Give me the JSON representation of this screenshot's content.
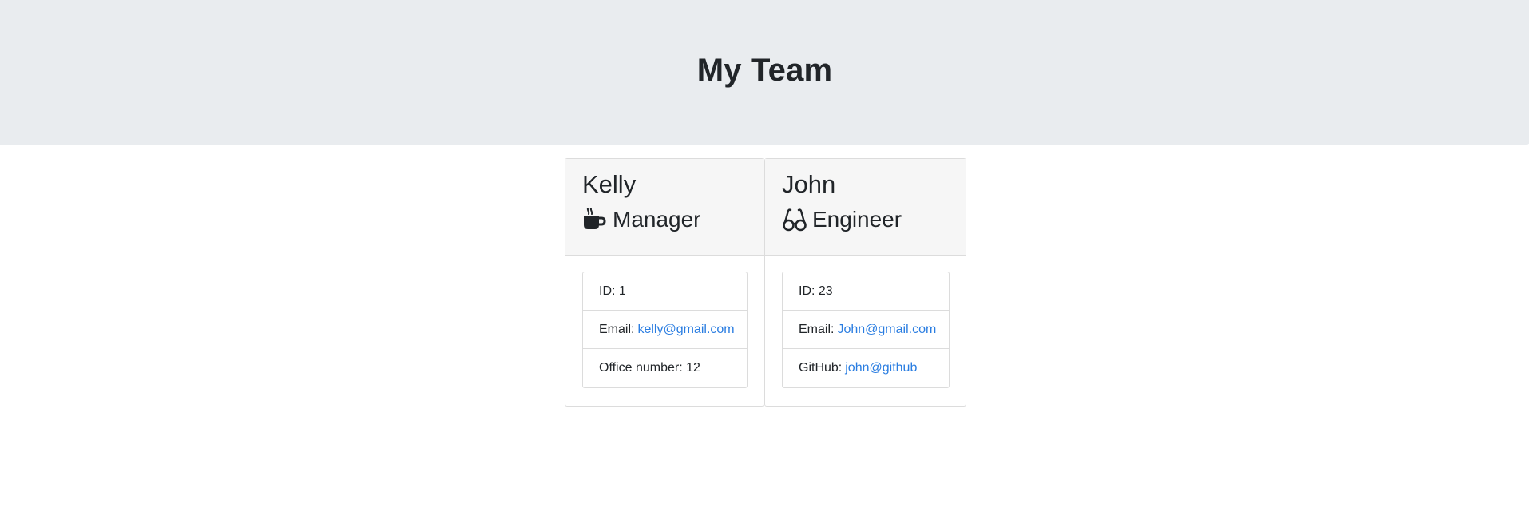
{
  "header": {
    "title": "My Team"
  },
  "team": [
    {
      "name": "Kelly",
      "role": "Manager",
      "role_icon": "coffee-icon",
      "id_label": "ID: 1",
      "email_label": "Email:",
      "email": "kelly@gmail.com",
      "extra_label": "Office number: 12"
    },
    {
      "name": "John",
      "role": "Engineer",
      "role_icon": "glasses-icon",
      "id_label": "ID: 23",
      "email_label": "Email:",
      "email": "John@gmail.com",
      "extra_label": "GitHub:",
      "extra_link": "john@github"
    }
  ],
  "colors": {
    "link": "#2a7de1",
    "header_bg": "#e9ecef",
    "card_header_bg": "#f6f6f6"
  }
}
